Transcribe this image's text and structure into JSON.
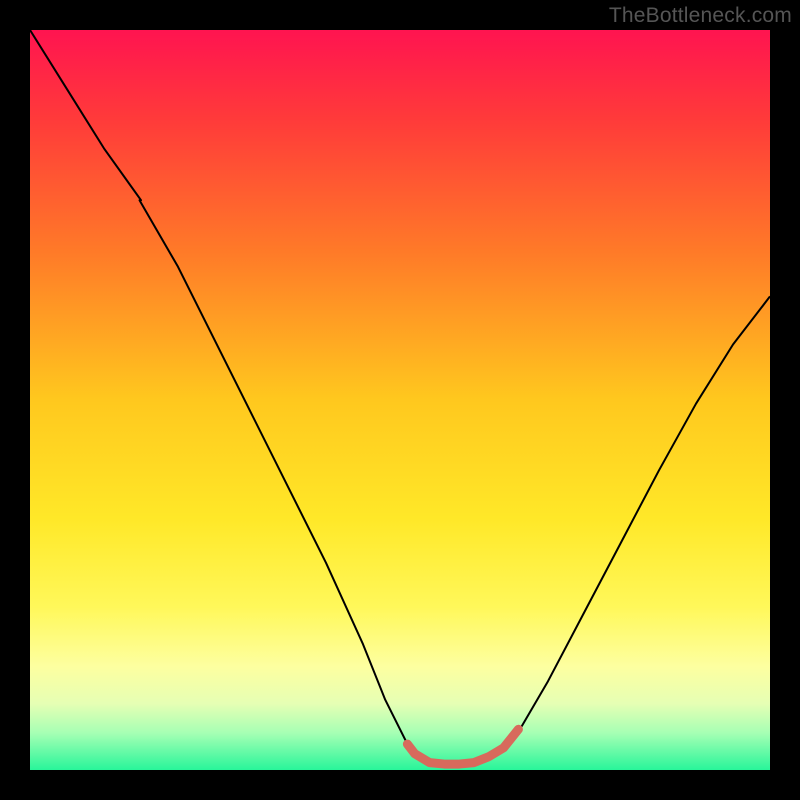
{
  "watermark": "TheBottleneck.com",
  "chart_data": {
    "type": "line",
    "title": "",
    "xlabel": "",
    "ylabel": "",
    "xlim": [
      0,
      1
    ],
    "ylim": [
      0,
      1
    ],
    "grid": false,
    "legend": false,
    "background_gradient_stops": [
      {
        "offset": 0.0,
        "color": "#ff1450"
      },
      {
        "offset": 0.12,
        "color": "#ff3a3a"
      },
      {
        "offset": 0.3,
        "color": "#ff7a28"
      },
      {
        "offset": 0.5,
        "color": "#ffc81e"
      },
      {
        "offset": 0.66,
        "color": "#ffe828"
      },
      {
        "offset": 0.78,
        "color": "#fff85a"
      },
      {
        "offset": 0.86,
        "color": "#fdffa0"
      },
      {
        "offset": 0.91,
        "color": "#e6ffb4"
      },
      {
        "offset": 0.95,
        "color": "#a6ffb4"
      },
      {
        "offset": 1.0,
        "color": "#28f59a"
      }
    ],
    "series": [
      {
        "name": "bottleneck-curve",
        "color": "#000000",
        "width": 2.0,
        "x": [
          0.0,
          0.05,
          0.1,
          0.15,
          0.148,
          0.2,
          0.25,
          0.3,
          0.35,
          0.4,
          0.45,
          0.48,
          0.51,
          0.52,
          0.54,
          0.56,
          0.58,
          0.6,
          0.62,
          0.64,
          0.665,
          0.7,
          0.75,
          0.8,
          0.85,
          0.9,
          0.95,
          1.0
        ],
        "y": [
          1.0,
          0.92,
          0.84,
          0.77,
          0.77,
          0.68,
          0.58,
          0.48,
          0.38,
          0.28,
          0.17,
          0.095,
          0.035,
          0.022,
          0.01,
          0.008,
          0.008,
          0.01,
          0.018,
          0.03,
          0.06,
          0.12,
          0.215,
          0.31,
          0.405,
          0.495,
          0.575,
          0.64
        ]
      },
      {
        "name": "flat-bottom-marker",
        "color": "#d86a5c",
        "width": 9,
        "linecap": "round",
        "x": [
          0.51,
          0.52,
          0.54,
          0.56,
          0.58,
          0.6,
          0.62,
          0.64,
          0.66
        ],
        "y": [
          0.035,
          0.022,
          0.01,
          0.008,
          0.008,
          0.01,
          0.018,
          0.03,
          0.055
        ]
      }
    ],
    "green_band": {
      "y_from": 0.0,
      "y_to": 0.045
    }
  }
}
